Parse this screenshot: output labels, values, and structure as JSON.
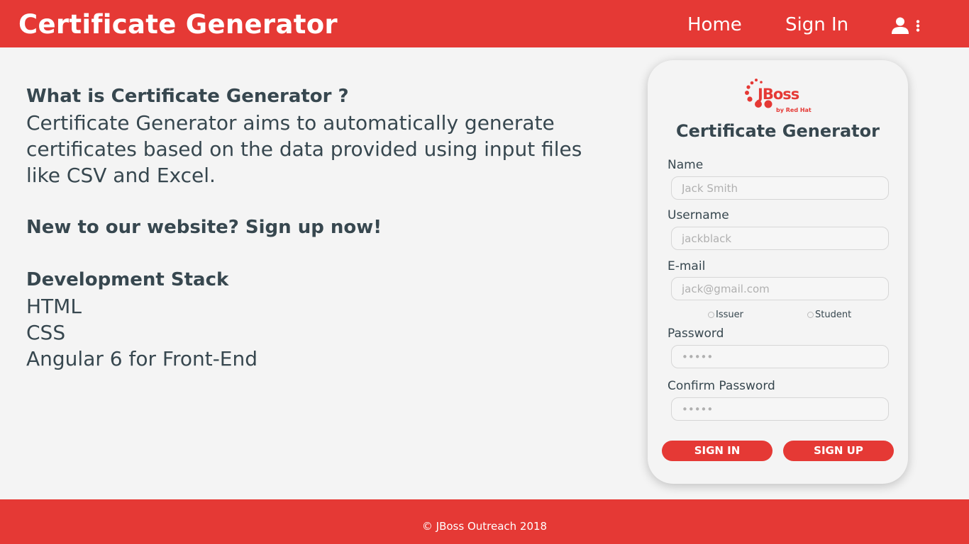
{
  "header": {
    "title": "Certificate Generator",
    "nav": {
      "home": "Home",
      "sign_in": "Sign In"
    },
    "icons": {
      "user": "user-icon",
      "menu": "kebab-menu-icon"
    }
  },
  "about": {
    "heading": "What is Certificate Generator ?",
    "lines": [
      "Certificate Generator aims to automatically generate",
      "certificates based on the data provided using input files",
      "like CSV and Excel."
    ],
    "signup_prompt": "New to our website? Sign up now!",
    "stack_heading": "Development Stack",
    "stack": [
      "HTML",
      "CSS",
      "Angular 6 for Front-End"
    ]
  },
  "form": {
    "logo": {
      "brand": "JBoss",
      "sub": "by Red Hat"
    },
    "title": "Certificate Generator",
    "fields": {
      "name": {
        "label": "Name",
        "placeholder": "Jack Smith"
      },
      "username": {
        "label": "Username",
        "placeholder": "jackblack"
      },
      "email": {
        "label": "E-mail",
        "placeholder": "jack@gmail.com"
      },
      "password": {
        "label": "Password",
        "placeholder": "•••••"
      },
      "confirm": {
        "label": "Confirm Password",
        "placeholder": "•••••"
      }
    },
    "roles": [
      "Issuer",
      "Student"
    ],
    "buttons": {
      "sign_in": "SIGN IN",
      "sign_up": "SIGN UP"
    }
  },
  "footer": {
    "text": "©  JBoss Outreach 2018"
  },
  "colors": {
    "accent": "#e53935",
    "text": "#37474f",
    "background": "#f4f4f4"
  }
}
